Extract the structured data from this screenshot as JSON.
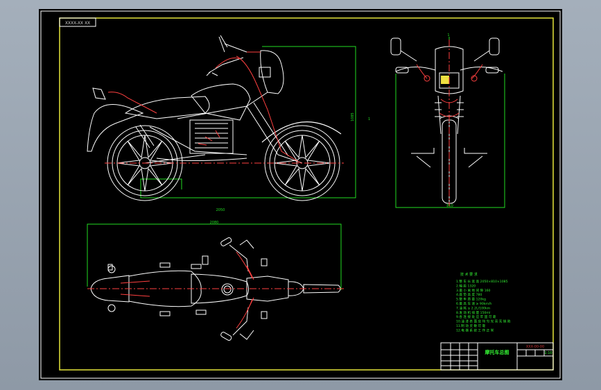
{
  "viewport": {
    "background": "#000000"
  },
  "colors": {
    "frame": "#ffffff",
    "border": "#e6e63a",
    "outline": "#ffffff",
    "dimension": "#22dd22",
    "centerline": "#ff3333",
    "detail_red": "#ff4040",
    "yellow_fill": "#f0e040",
    "notes_text": "#33ee33"
  },
  "drawing": {
    "code_label": "XXXX-XX XX",
    "side_view": {
      "dim_length": "2050",
      "dim_height": "1085",
      "dim_height_alt": "1"
    },
    "front_view": {
      "dim_top": "1",
      "dim_width": "810"
    },
    "top_view": {
      "dim_length": "2080"
    },
    "notes": {
      "header": "技 术 要 求",
      "lines": [
        "1.整 车 长 宽 高 2050×810×1085",
        "2.轴 距 1320",
        "3.最 小 离 地 间 隙 160",
        "4.座 垫 高 度 780",
        "5.整 车 质 量 120kg",
        "6.最 高 车 速 ≥ 90km/h",
        "7.油 耗 ≤ 2.2L/100km",
        "8.发 动 机 排 量 150ml",
        "9.各 连 接 处 应 牢 固 可 靠",
        "10.油 漆 表 面 应 均 匀 光 亮 无 缺 陷",
        "11.制 动 灵 敏 可 靠",
        "12.电 器 系 统 工 作 正 常"
      ]
    },
    "title_block": {
      "main_title": "摩托车总图",
      "part_no": "XXX-00-00",
      "scale": "1:10"
    }
  }
}
